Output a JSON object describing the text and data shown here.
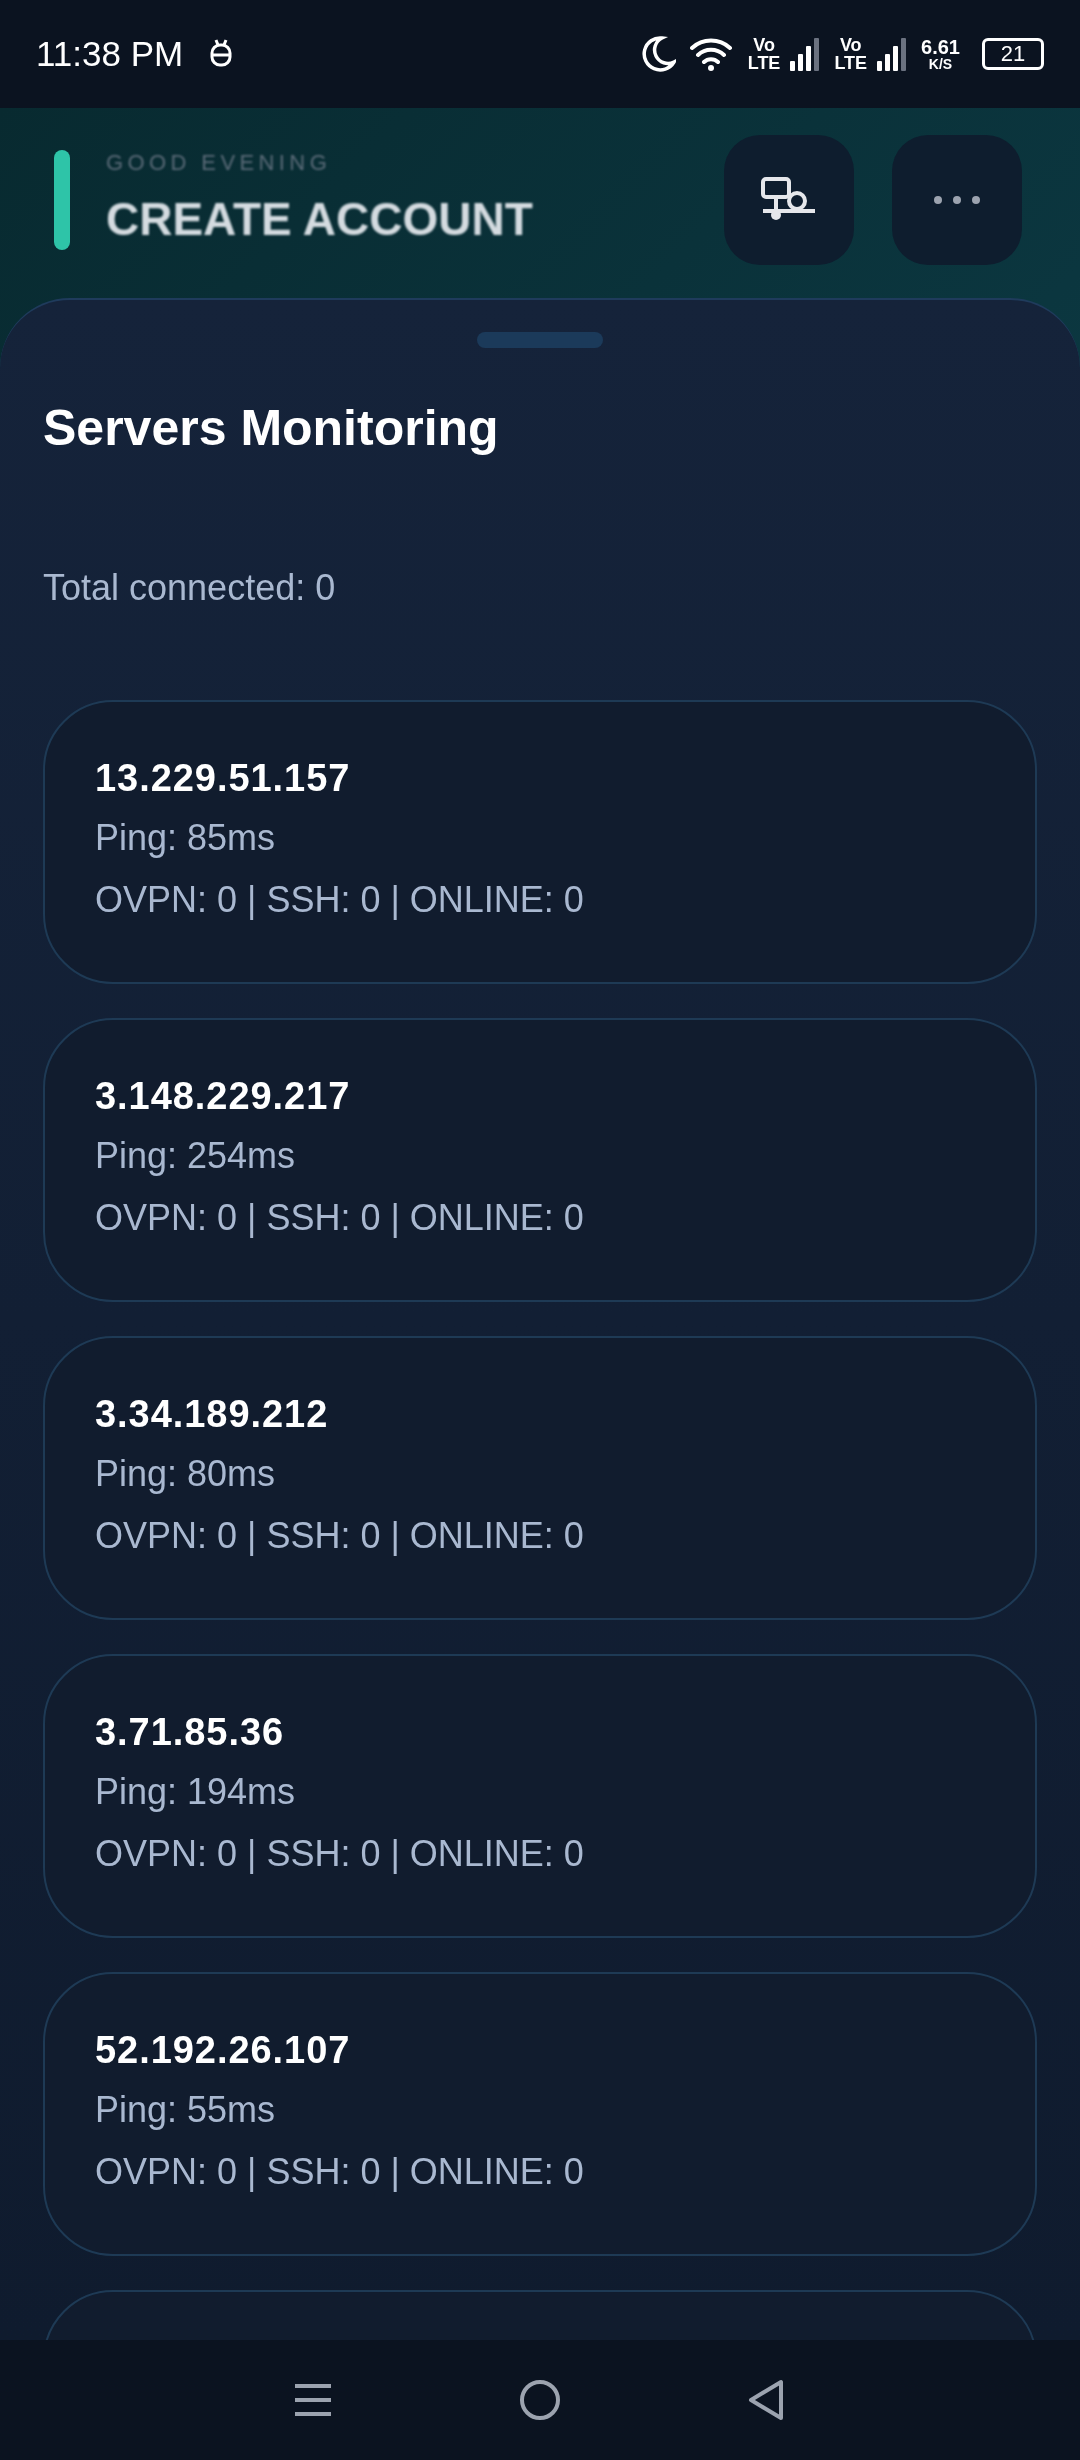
{
  "status_bar": {
    "time": "11:38 PM",
    "network_speed": "6.61",
    "network_speed_unit": "K/S",
    "battery": "21",
    "sims": [
      {
        "label_top": "Vo",
        "label_bottom": "LTE"
      },
      {
        "label_top": "Vo",
        "label_bottom": "LTE"
      }
    ]
  },
  "header": {
    "greeting": "GOOD EVENING",
    "title": "CREATE ACCOUNT"
  },
  "sheet": {
    "title": "Servers Monitoring",
    "total": "Total connected: 0",
    "servers": [
      {
        "ip": "13.229.51.157",
        "ping": "Ping: 85ms",
        "stats": "OVPN: 0 | SSH: 0 | ONLINE: 0"
      },
      {
        "ip": "3.148.229.217",
        "ping": "Ping: 254ms",
        "stats": "OVPN: 0 | SSH: 0 | ONLINE: 0"
      },
      {
        "ip": "3.34.189.212",
        "ping": "Ping: 80ms",
        "stats": "OVPN: 0 | SSH: 0 | ONLINE: 0"
      },
      {
        "ip": "3.71.85.36",
        "ping": "Ping: 194ms",
        "stats": "OVPN: 0 | SSH: 0 | ONLINE: 0"
      },
      {
        "ip": "52.192.26.107",
        "ping": "Ping: 55ms",
        "stats": "OVPN: 0 | SSH: 0 | ONLINE: 0"
      }
    ]
  }
}
